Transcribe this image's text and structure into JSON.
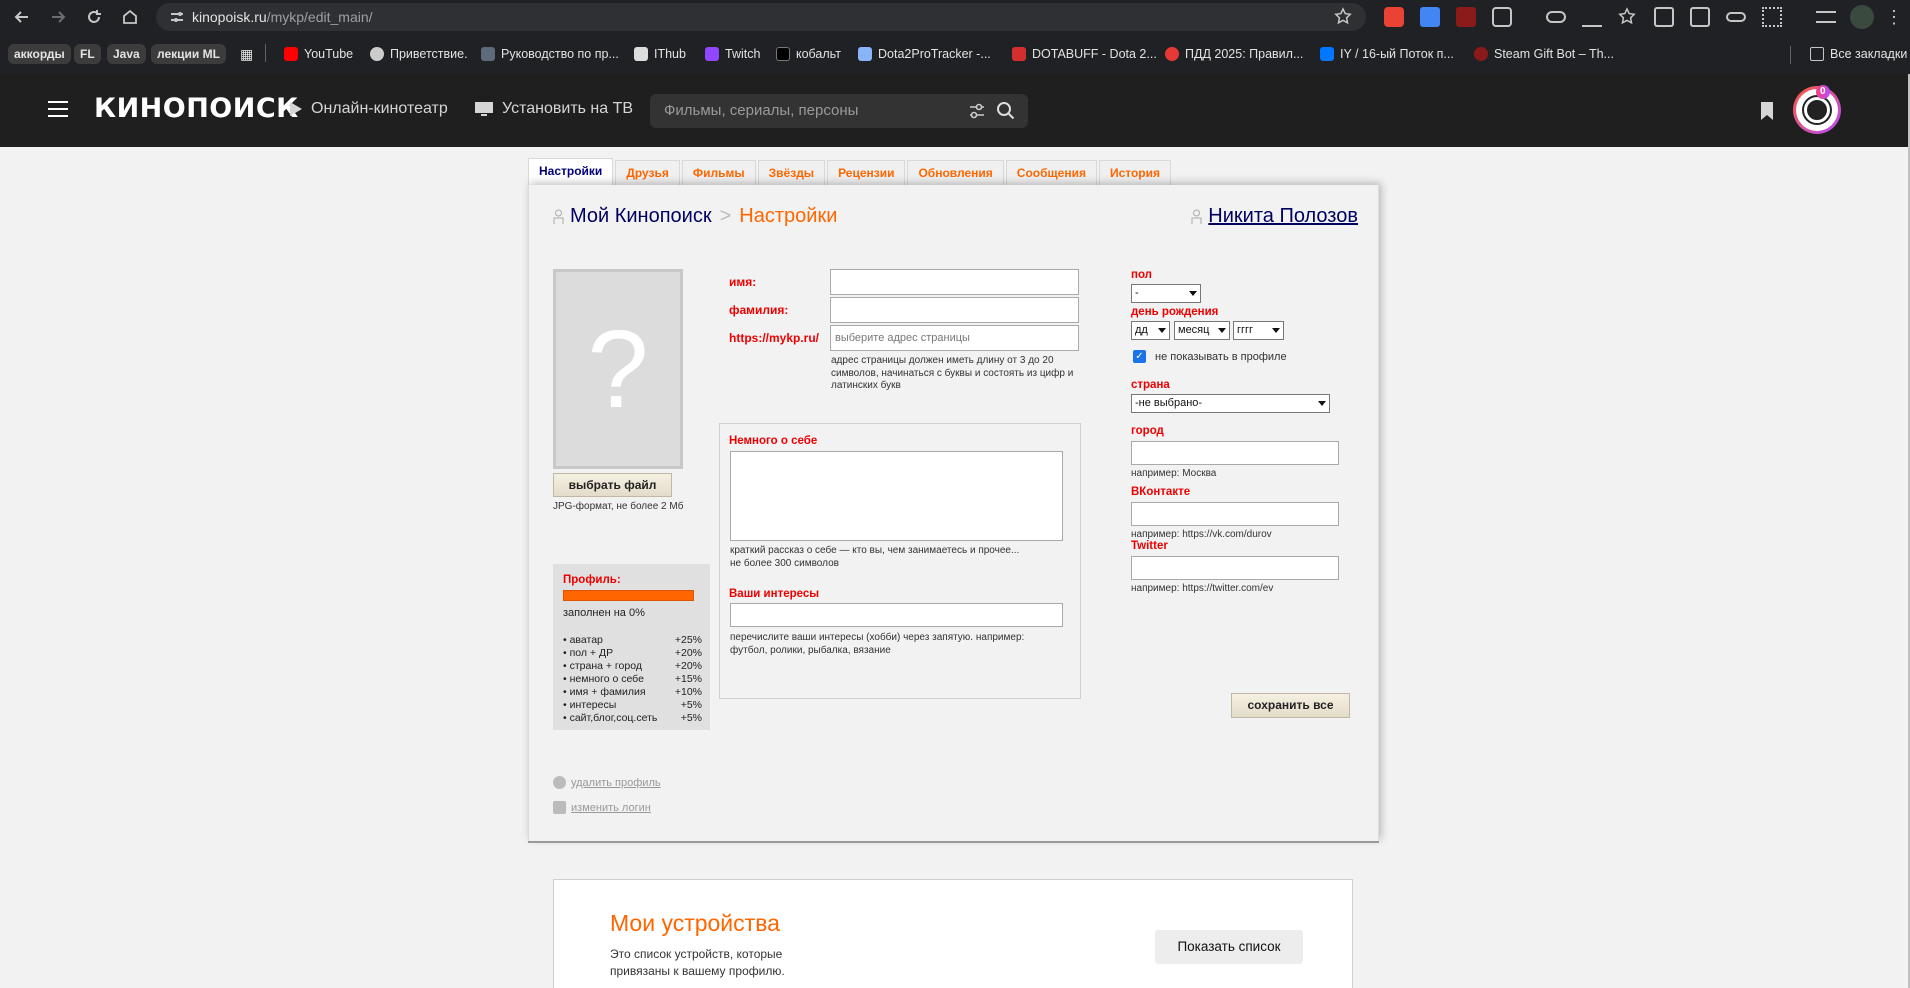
{
  "browser": {
    "url_domain": "kinopoisk.ru",
    "url_path": "/mykp/edit_main/",
    "bookmarks": [
      {
        "label": "аккорды",
        "chip": true
      },
      {
        "label": "FL",
        "chip": true
      },
      {
        "label": "Java",
        "chip": true
      },
      {
        "label": "лекции ML",
        "chip": true
      },
      {
        "label": "YouTube",
        "color": "#ff0000"
      },
      {
        "label": "Приветствие.",
        "color": "#cccccc"
      },
      {
        "label": "Руководство по пр...",
        "color": "#5f6b7a"
      },
      {
        "label": "IThub",
        "color": "#dddddd"
      },
      {
        "label": "Twitch",
        "color": "#9146ff"
      },
      {
        "label": "кобальт",
        "color": "#000000"
      },
      {
        "label": "Dota2ProTracker -...",
        "color": "#8ab4f8"
      },
      {
        "label": "DOTABUFF - Dota 2...",
        "color": "#d32f2f"
      },
      {
        "label": "ПДД 2025: Правил...",
        "color": "#e53935"
      },
      {
        "label": "IY / 16-ый Поток п...",
        "color": "#0077ff"
      },
      {
        "label": "Steam Gift Bot – Th...",
        "color": "#8b1a1a"
      }
    ],
    "all_bookmarks": "Все закладки"
  },
  "site": {
    "logo": "КИНОПОИСК",
    "online_cinema": "Онлайн-кинотеатр",
    "install_tv": "Установить на ТВ",
    "search_placeholder": "Фильмы, сериалы, персоны",
    "notif_count": "0"
  },
  "tabs": [
    "Настройки",
    "Друзья",
    "Фильмы",
    "Звёзды",
    "Рецензии",
    "Обновления",
    "Сообщения",
    "История"
  ],
  "breadcrumb": {
    "root": "Мой Кинопоиск",
    "sep": ">",
    "current": "Настройки",
    "user_name": "Никита Полозов"
  },
  "avatar": {
    "placeholder_glyph": "?",
    "choose_file": "выбрать файл",
    "format_hint": "JPG-формат, не более 2 Мб"
  },
  "profile": {
    "title": "Профиль:",
    "filled": "заполнен на 0%",
    "fill_fraction": 0,
    "items": [
      {
        "label": "• аватар",
        "value": "+25%"
      },
      {
        "label": "• пол + ДР",
        "value": "+20%"
      },
      {
        "label": "• страна + город",
        "value": "+20%"
      },
      {
        "label": "• немного о себе",
        "value": "+15%"
      },
      {
        "label": "• имя + фамилия",
        "value": "+10%"
      },
      {
        "label": "• интересы",
        "value": "+5%"
      },
      {
        "label": "• сайт,блог,соц.сеть",
        "value": "+5%"
      }
    ]
  },
  "links": {
    "delete_profile": "удалить профиль",
    "change_login": "изменить логин"
  },
  "form": {
    "name_label": "имя:",
    "surname_label": "фамилия:",
    "url_label": "https://mykp.ru/",
    "url_placeholder": "выберите адрес страницы",
    "url_hint": "адрес страницы должен иметь длину от 3 до 20 символов, начинаться с буквы и состоять из цифр и латинских букв",
    "about_label": "Немного о себе",
    "about_hint": "краткий рассказ о себе — кто вы, чем занимаетесь и прочее... не более 300 символов",
    "interests_label": "Ваши интересы",
    "interests_hint": "перечислите ваши интересы (хобби) через запятую. например: футбол, ролики, рыбалка, вязание"
  },
  "right": {
    "gender_label": "пол",
    "gender_value": "-",
    "birthday_label": "день рождения",
    "day": "дд",
    "month": "месяц",
    "year": "гггг",
    "hide_in_profile": "не показывать в профиле",
    "hide_checked": true,
    "country_label": "страна",
    "country_value": "-не выбрано-",
    "city_label": "город",
    "city_hint": "например: Москва",
    "vk_label": "ВКонтакте",
    "vk_hint": "например: https://vk.com/durov",
    "twitter_label": "Twitter",
    "twitter_hint": "например: https://twitter.com/ev",
    "save_all": "сохранить все"
  },
  "devices": {
    "title": "Мои устройства",
    "desc": "Это список устройств, которые привязаны к вашему профилю.",
    "show_list": "Показать список"
  }
}
